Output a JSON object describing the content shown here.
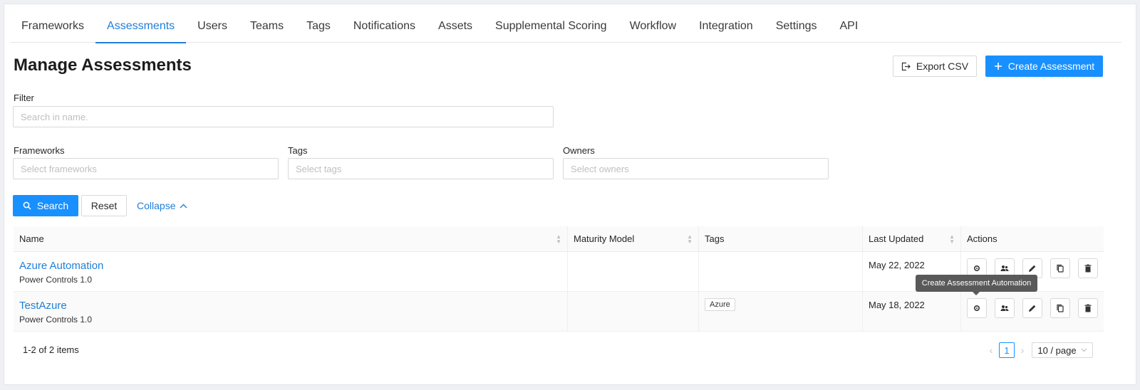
{
  "nav": {
    "tabs": [
      {
        "label": "Frameworks"
      },
      {
        "label": "Assessments"
      },
      {
        "label": "Users"
      },
      {
        "label": "Teams"
      },
      {
        "label": "Tags"
      },
      {
        "label": "Notifications"
      },
      {
        "label": "Assets"
      },
      {
        "label": "Supplemental Scoring"
      },
      {
        "label": "Workflow"
      },
      {
        "label": "Integration"
      },
      {
        "label": "Settings"
      },
      {
        "label": "API"
      }
    ],
    "active": "Assessments"
  },
  "page": {
    "title": "Manage Assessments"
  },
  "toolbar": {
    "export_label": "Export CSV",
    "create_label": "Create Assessment"
  },
  "filter": {
    "label": "Filter",
    "search_placeholder": "Search in name.",
    "frameworks_label": "Frameworks",
    "frameworks_placeholder": "Select frameworks",
    "tags_label": "Tags",
    "tags_placeholder": "Select tags",
    "owners_label": "Owners",
    "owners_placeholder": "Select owners",
    "search_button": "Search",
    "reset_button": "Reset",
    "collapse_link": "Collapse"
  },
  "table": {
    "columns": [
      "Name",
      "Maturity Model",
      "Tags",
      "Last Updated",
      "Actions"
    ],
    "rows": [
      {
        "name": "Azure Automation",
        "framework": "Power Controls 1.0",
        "maturity": "",
        "tag": "",
        "updated": "May 22, 2022"
      },
      {
        "name": "TestAzure",
        "framework": "Power Controls 1.0",
        "maturity": "",
        "tag": "Azure",
        "updated": "May 18, 2022"
      }
    ],
    "tooltip": "Create Assessment Automation"
  },
  "pagination": {
    "summary": "1-2 of 2 items",
    "current_page": "1",
    "page_size": "10 / page"
  },
  "colors": {
    "accent": "#1890ff",
    "link": "#1f7fd8"
  }
}
